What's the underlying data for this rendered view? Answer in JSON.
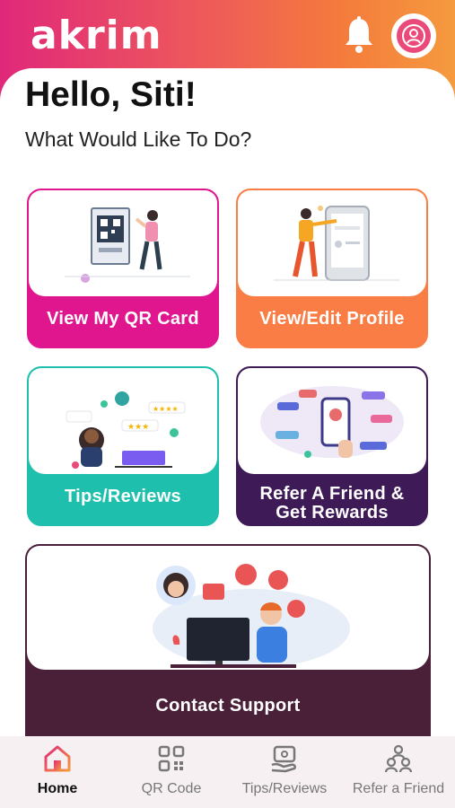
{
  "header": {
    "logo_text": "akrim",
    "icons": [
      "bell-icon",
      "profile-icon"
    ],
    "gradient": [
      "#e0287a",
      "#f59a3e"
    ]
  },
  "greeting": "Hello, Siti!",
  "subtitle": "What Would Like To Do?",
  "cards": [
    {
      "label": "View My QR Card",
      "color": "#e0168e"
    },
    {
      "label": "View/Edit Profile",
      "color": "#f97d45"
    },
    {
      "label": "Tips/Reviews",
      "color": "#1ec0ad"
    },
    {
      "label_line1": "Refer A Friend &",
      "label_line2": "Get Rewards",
      "color": "#3e1a57"
    },
    {
      "label": "Contact Support",
      "color": "#4a2038"
    }
  ],
  "nav": {
    "items": [
      {
        "label": "Home",
        "icon": "home-icon",
        "active": true
      },
      {
        "label": "QR Code",
        "icon": "qr-code-icon",
        "active": false
      },
      {
        "label": "Tips/Reviews",
        "icon": "tips-icon",
        "active": false
      },
      {
        "label": "Refer a Friend",
        "icon": "refer-icon",
        "active": false
      }
    ]
  }
}
